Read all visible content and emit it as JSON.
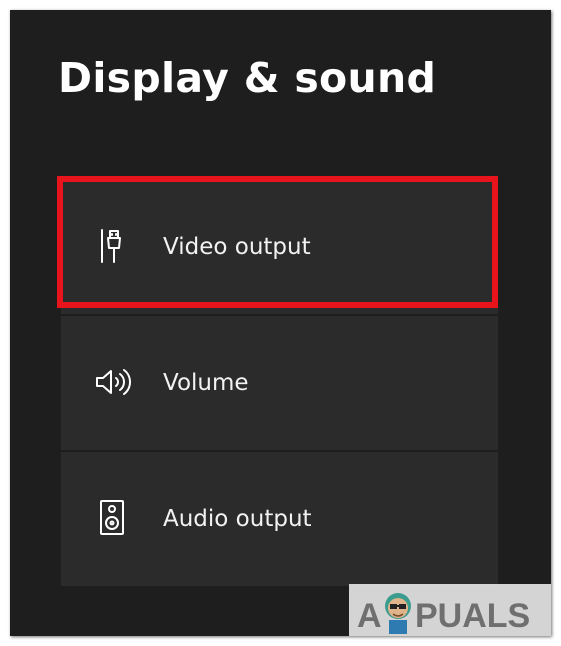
{
  "page": {
    "title": "Display & sound"
  },
  "menu": {
    "items": [
      {
        "label": "Video output",
        "icon": "hdmi-connector-icon",
        "highlighted": true
      },
      {
        "label": "Volume",
        "icon": "speaker-volume-icon",
        "highlighted": false
      },
      {
        "label": "Audio output",
        "icon": "audio-device-icon",
        "highlighted": false
      }
    ]
  },
  "watermark": {
    "text": "APPUALS"
  },
  "colors": {
    "background": "#1e1e1e",
    "tile": "#2b2b2b",
    "text": "#ffffff",
    "highlight": "#e8141b"
  }
}
